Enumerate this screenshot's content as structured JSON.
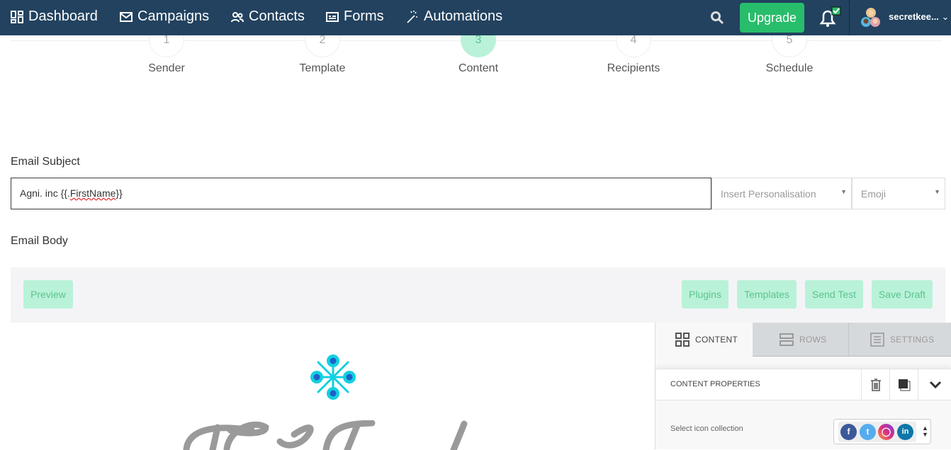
{
  "nav": {
    "items": [
      {
        "label": "Dashboard",
        "icon": "dashboard-icon"
      },
      {
        "label": "Campaigns",
        "icon": "envelope-icon"
      },
      {
        "label": "Contacts",
        "icon": "contacts-icon"
      },
      {
        "label": "Forms",
        "icon": "form-icon"
      },
      {
        "label": "Automations",
        "icon": "magic-wand-icon"
      }
    ],
    "upgrade_label": "Upgrade",
    "username": "secretkee...",
    "colors": {
      "bar": "#22425f",
      "upgrade": "#28bd6b"
    }
  },
  "steps": [
    {
      "num": "1",
      "label": "Sender"
    },
    {
      "num": "2",
      "label": "Template"
    },
    {
      "num": "3",
      "label": "Content",
      "active": true
    },
    {
      "num": "4",
      "label": "Recipients"
    },
    {
      "num": "5",
      "label": "Schedule"
    }
  ],
  "subject": {
    "label": "Email Subject",
    "value_prefix": "Agni. inc {{.",
    "value_token": "FirstName",
    "value_suffix": "}}",
    "personalisation_placeholder": "Insert Personalisation",
    "emoji_placeholder": "Emoji"
  },
  "body": {
    "label": "Email Body",
    "preview": "Preview",
    "plugins": "Plugins",
    "templates": "Templates",
    "send_test": "Send Test",
    "save_draft": "Save Draft"
  },
  "panel": {
    "tabs": [
      "CONTENT",
      "ROWS",
      "SETTINGS"
    ],
    "properties_title": "CONTENT PROPERTIES",
    "icon_collection_label": "Select icon collection",
    "social_icons": [
      "facebook-icon",
      "twitter-icon",
      "instagram-icon",
      "linkedin-icon"
    ]
  }
}
